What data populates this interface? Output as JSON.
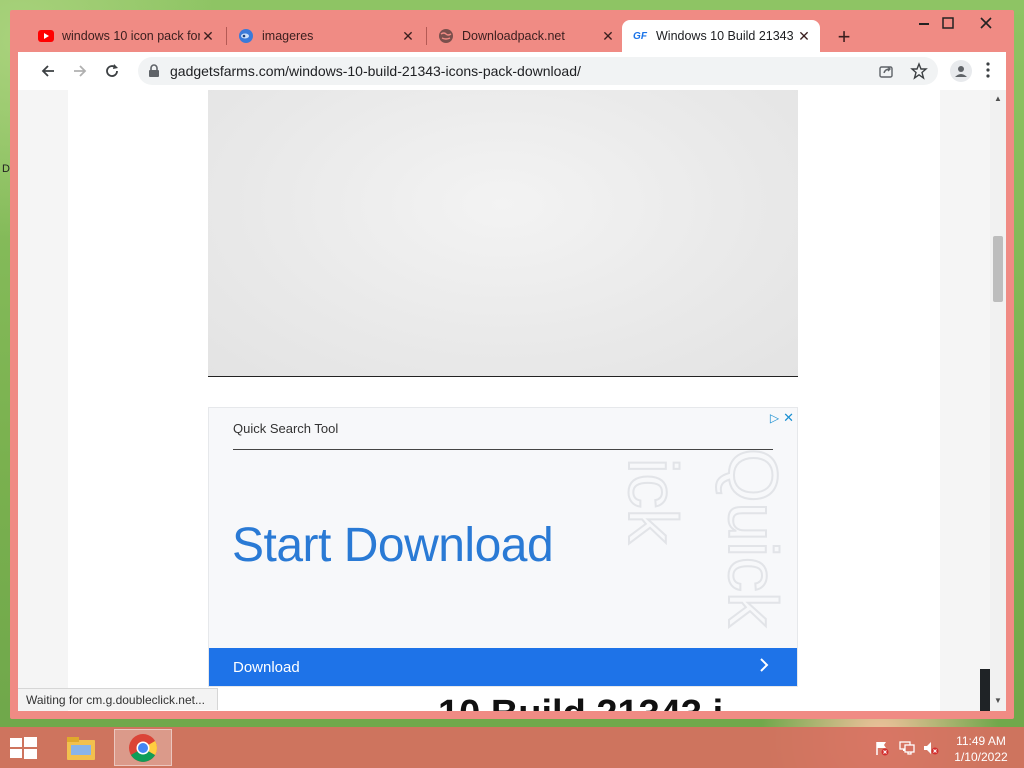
{
  "browser": {
    "tabs": [
      {
        "title": "windows 10 icon pack for",
        "favicon": "youtube-icon",
        "active": false
      },
      {
        "title": "imageres",
        "favicon": "site-logo-icon",
        "active": false
      },
      {
        "title": "Downloadpack.net",
        "favicon": "globe-icon",
        "active": false
      },
      {
        "title": "Windows 10 Build 21343",
        "favicon": "gf-logo-icon",
        "favicon_text": "GF",
        "active": true
      }
    ],
    "url": "gadgetsfarms.com/windows-10-build-21343-icons-pack-download/",
    "status_text": "Waiting for cm.g.doubleclick.net..."
  },
  "ad": {
    "brand": "Quick Search Tool",
    "headline": "Start Download",
    "cta_label": "Download",
    "watermark": "Quick",
    "accent_color": "#1e73e8"
  },
  "article": {
    "peek_text": "10 Build 21343 i"
  },
  "desktop": {
    "edge_glyph": "D"
  },
  "taskbar": {
    "apps": [
      "file-explorer-icon",
      "chrome-icon"
    ],
    "clock_time": "11:49 AM",
    "clock_date": "1/10/2022"
  },
  "colors": {
    "frame": "#f08b84",
    "taskbar": "#d67060"
  }
}
